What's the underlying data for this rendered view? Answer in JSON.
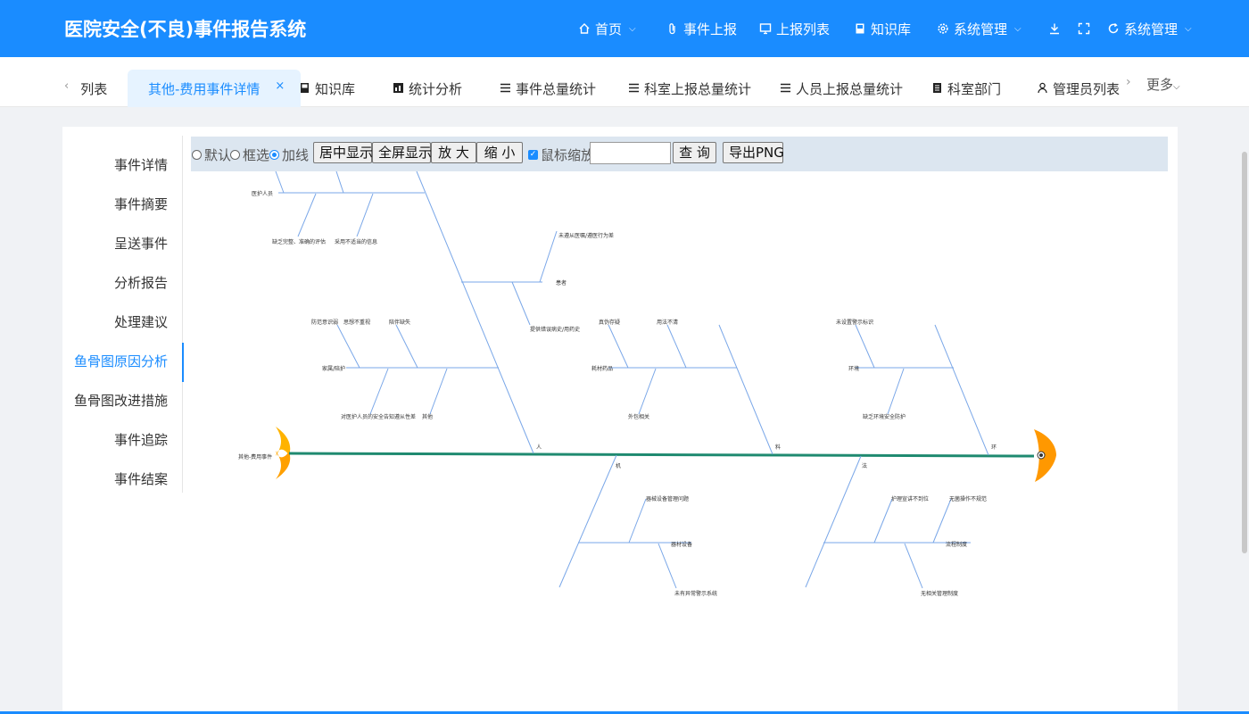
{
  "header": {
    "title": "医院安全(不良)事件报告系统",
    "nav": [
      {
        "label": "首页",
        "icon": "home-icon",
        "has_dropdown": true
      },
      {
        "label": "事件上报",
        "icon": "paperclip-icon",
        "has_dropdown": false
      },
      {
        "label": "上报列表",
        "icon": "monitor-icon",
        "has_dropdown": false
      },
      {
        "label": "知识库",
        "icon": "book-icon",
        "has_dropdown": false
      },
      {
        "label": "系统管理",
        "icon": "gear-icon",
        "has_dropdown": true
      },
      {
        "label": "系统管理",
        "icon": "sync-icon",
        "has_dropdown": true
      }
    ]
  },
  "tabs": {
    "items": [
      {
        "label": "列表",
        "icon": ""
      },
      {
        "label": "其他-费用事件详情",
        "icon": "",
        "active": true
      },
      {
        "label": "知识库",
        "icon": "book-icon"
      },
      {
        "label": "统计分析",
        "icon": "chart-icon"
      },
      {
        "label": "事件总量统计",
        "icon": "list-icon"
      },
      {
        "label": "科室上报总量统计",
        "icon": "list-icon"
      },
      {
        "label": "人员上报总量统计",
        "icon": "list-icon"
      },
      {
        "label": "科室部门",
        "icon": "document-icon"
      },
      {
        "label": "管理员列表",
        "icon": "user-icon"
      }
    ],
    "close_symbol": "×",
    "more": "更多"
  },
  "side_menu": {
    "items": [
      "事件详情",
      "事件摘要",
      "呈送事件",
      "分析报告",
      "处理建议",
      "鱼骨图原因分析",
      "鱼骨图改进措施",
      "事件追踪",
      "事件结案"
    ],
    "active_index": 5
  },
  "toolbar": {
    "mode_options": [
      "默认",
      "框选",
      "加线"
    ],
    "selected_mode": "加线",
    "buttons": [
      "居中显示",
      "全屏显示",
      "放 大",
      "缩 小"
    ],
    "mouse_zoom_label": "鼠标缩放",
    "mouse_zoom_checked": true,
    "search_value": "",
    "query_button": "查 询",
    "export_button": "导出PNG"
  },
  "fishbone": {
    "problem": "其他-费用事件",
    "categories": [
      {
        "name": "人",
        "causes": [
          "医护人员",
          "患者",
          "家属/陪护",
          "其他"
        ]
      },
      {
        "name": "料",
        "causes": [
          "耗材药品",
          "外包相关"
        ]
      },
      {
        "name": "环",
        "causes": [
          "环境",
          "缺乏环境安全防护"
        ]
      },
      {
        "name": "机",
        "causes": [
          "器械设备管理问题",
          "器材设备",
          "未有异常警示系统"
        ]
      },
      {
        "name": "法",
        "causes": [
          "护理宣讲不到位",
          "无菌操作不规范",
          "流程制度",
          "无相关管理制度"
        ]
      }
    ],
    "sub_causes": {
      "医护人员": [
        "缺乏完整、准确的评估",
        "采用不适当的信息"
      ],
      "患者": [
        "未遵从医嘱/遵医行为差",
        "提供错误病史/用药史"
      ],
      "家属/陪护": [
        "防范意识弱",
        "思想不重视",
        "陪伴缺失",
        "对医护人员的安全告知遵从性差"
      ],
      "耗材药品": [
        "真伪存疑",
        "用法不清"
      ],
      "环境": [
        "未设置警示标识"
      ]
    }
  }
}
